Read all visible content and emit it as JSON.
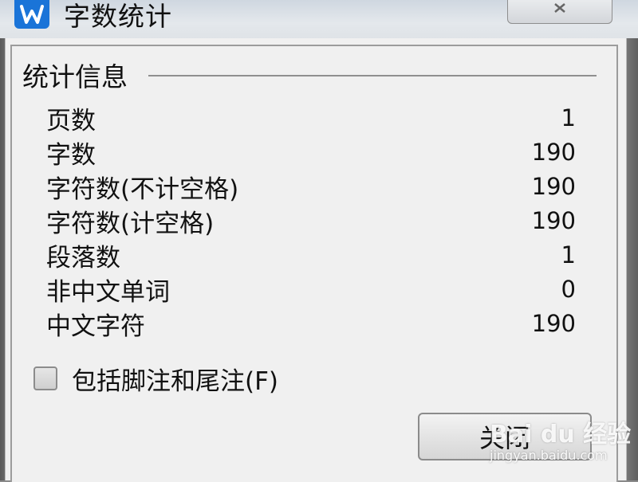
{
  "window": {
    "title": "字数统计",
    "app_icon": "wps-writer-icon"
  },
  "group": {
    "title": "统计信息"
  },
  "stats": [
    {
      "label": "页数",
      "value": "1"
    },
    {
      "label": "字数",
      "value": "190"
    },
    {
      "label": "字符数(不计空格)",
      "value": "190"
    },
    {
      "label": "字符数(计空格)",
      "value": "190"
    },
    {
      "label": "段落数",
      "value": "1"
    },
    {
      "label": "非中文单词",
      "value": "0"
    },
    {
      "label": "中文字符",
      "value": "190"
    }
  ],
  "checkbox": {
    "label": "包括脚注和尾注(F)",
    "checked": false
  },
  "buttons": {
    "close_label": "关闭"
  },
  "watermark": {
    "logo_text": "Bai du 经验",
    "url": "jingyan.baidu.com"
  },
  "colors": {
    "icon_blue": "#1a74d8",
    "dialog_bg": "#f0f0f0"
  }
}
